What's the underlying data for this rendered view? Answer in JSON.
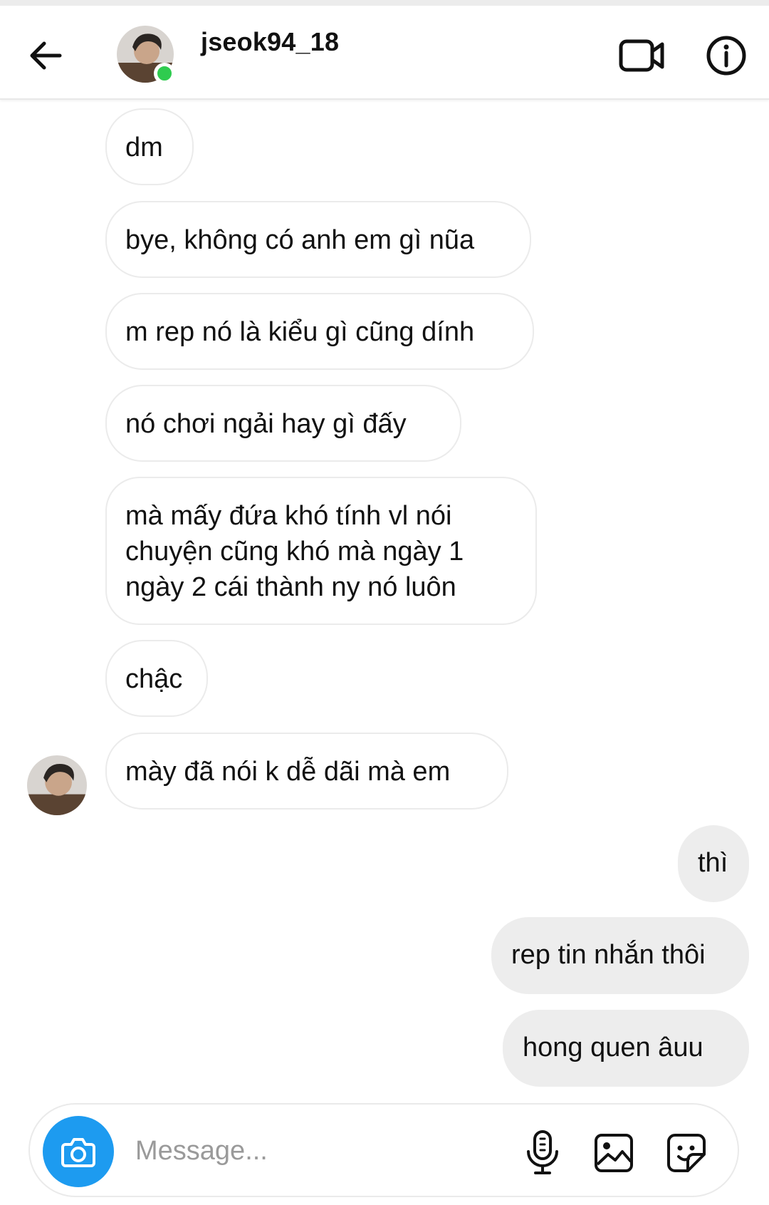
{
  "header": {
    "username": "jseok94_18",
    "status": "",
    "online_color": "#2fcb4f",
    "icons": {
      "back": "arrow-left-icon",
      "video": "video-camera-icon",
      "info": "info-circle-icon"
    }
  },
  "messages": [
    {
      "side": "incoming",
      "text": "dm"
    },
    {
      "side": "incoming",
      "text": "bye, không có anh em gì nũa"
    },
    {
      "side": "incoming",
      "text": "m rep nó là kiểu gì cũng dính"
    },
    {
      "side": "incoming",
      "text": "nó chơi ngải hay gì đấy"
    },
    {
      "side": "incoming",
      "text": "mà mấy đứa khó tính vl nói chuyện cũng khó mà ngày 1 ngày 2 cái thành ny nó luôn"
    },
    {
      "side": "incoming",
      "text": "chậc"
    },
    {
      "side": "incoming",
      "text": "mày đã nói k dễ dãi mà em"
    },
    {
      "side": "outgoing",
      "text": "thì"
    },
    {
      "side": "outgoing",
      "text": "rep tin nhắn thôi"
    },
    {
      "side": "outgoing",
      "text": "hong quen âuu"
    }
  ],
  "composer": {
    "placeholder": "Message...",
    "icons": {
      "camera": "camera-icon",
      "mic": "microphone-icon",
      "gallery": "image-icon",
      "sticker": "sticker-icon"
    },
    "camera_color": "#1d9bf0"
  },
  "colors": {
    "incoming_bubble": "#ffffff",
    "outgoing_bubble": "#ededed",
    "bubble_border": "#ebebeb"
  }
}
